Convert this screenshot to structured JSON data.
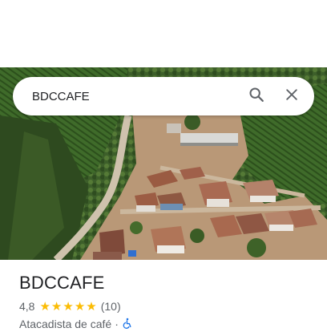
{
  "search": {
    "value": "BDCCAFE",
    "search_icon": "search-icon",
    "clear_icon": "close-icon"
  },
  "photo": {
    "subject": "aerial photo of coffee farm village"
  },
  "place": {
    "name": "BDCCAFE",
    "rating": "4,8",
    "stars": 5,
    "review_count": "(10)",
    "category": "Atacadista de café",
    "separator": "·",
    "accessibility_icon": "wheelchair-icon"
  },
  "colors": {
    "star": "#fbbc04",
    "accessibility": "#1a73e8"
  }
}
